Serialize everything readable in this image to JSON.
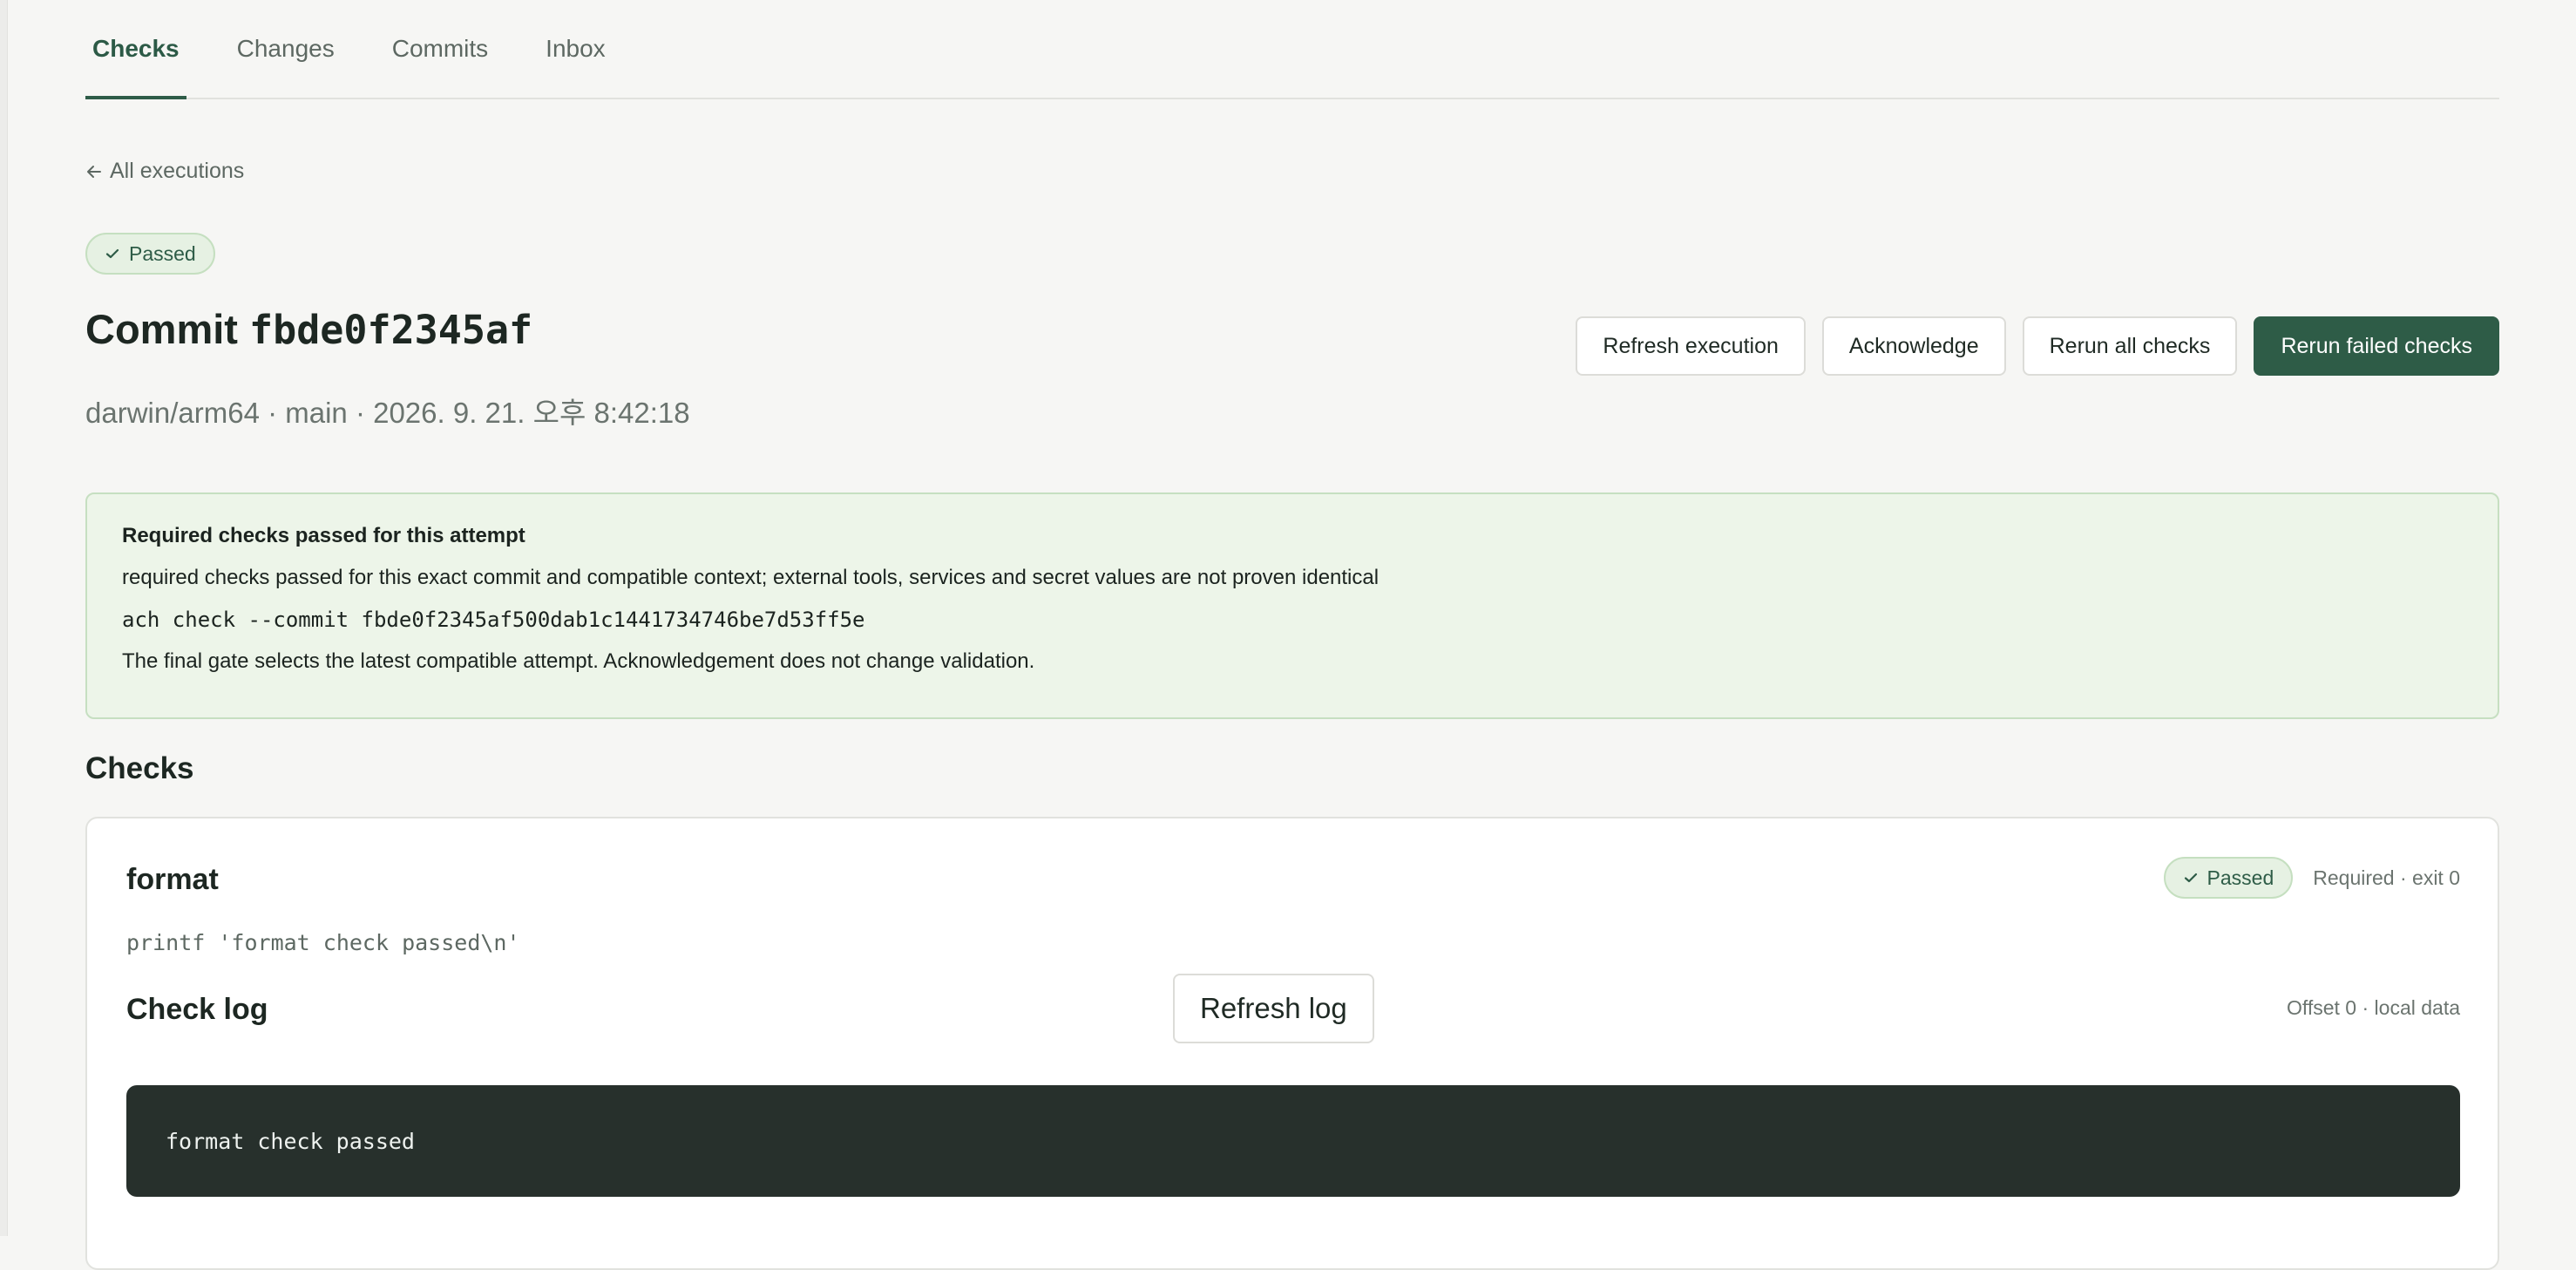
{
  "tabs": [
    {
      "label": "Checks",
      "active": true
    },
    {
      "label": "Changes",
      "active": false
    },
    {
      "label": "Commits",
      "active": false
    },
    {
      "label": "Inbox",
      "active": false
    }
  ],
  "back_link": {
    "icon": "arrow-left-icon",
    "label": "All executions"
  },
  "status": {
    "icon": "check-icon",
    "label": "Passed"
  },
  "title": {
    "prefix": "Commit",
    "commit": "fbde0f2345af"
  },
  "subtitle": "darwin/arm64 · main · 2026. 9. 21. 오후 8:42:18",
  "actions": {
    "refresh": "Refresh execution",
    "acknowledge": "Acknowledge",
    "rerun_all": "Rerun all checks",
    "rerun_failed": "Rerun failed checks"
  },
  "banner": {
    "title": "Required checks passed for this attempt",
    "message": "required checks passed for this exact commit and compatible context; external tools, services and secret values are not proven identical",
    "command": "ach check --commit fbde0f2345af500dab1c1441734746be7d53ff5e",
    "note": "The final gate selects the latest compatible attempt. Acknowledgement does not change validation."
  },
  "checks_section": {
    "title": "Checks"
  },
  "check": {
    "name": "format",
    "status": "Passed",
    "meta": "Required · exit 0",
    "command": "printf 'format check passed\\n'",
    "log_title": "Check log",
    "refresh_log": "Refresh log",
    "log_meta": "Offset 0 · local data",
    "log_output": "format check passed"
  },
  "colors": {
    "accent": "#2e5c47",
    "success_bg": "#edf5e9",
    "log_bg": "#27302c"
  }
}
